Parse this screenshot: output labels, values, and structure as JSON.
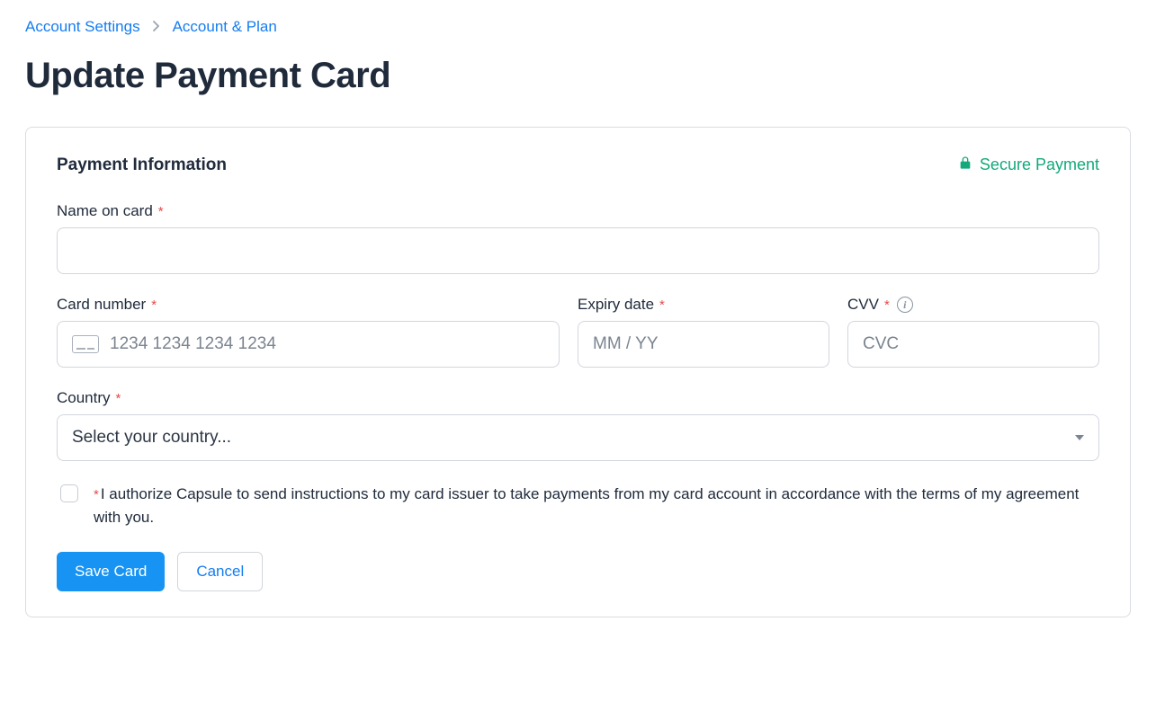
{
  "breadcrumb": {
    "items": [
      "Account Settings",
      "Account & Plan"
    ]
  },
  "page": {
    "title": "Update Payment Card"
  },
  "section": {
    "title": "Payment Information",
    "secure_label": "Secure Payment"
  },
  "fields": {
    "name": {
      "label": "Name on card",
      "value": ""
    },
    "card_number": {
      "label": "Card number",
      "placeholder": "1234 1234 1234 1234"
    },
    "expiry": {
      "label": "Expiry date",
      "placeholder": "MM / YY"
    },
    "cvv": {
      "label": "CVV",
      "placeholder": "CVC"
    },
    "country": {
      "label": "Country",
      "placeholder": "Select your country..."
    }
  },
  "consent": {
    "text": "I authorize Capsule to send instructions to my card issuer to take payments from my card account in accordance with the terms of my agreement with you."
  },
  "actions": {
    "save": "Save Card",
    "cancel": "Cancel"
  }
}
